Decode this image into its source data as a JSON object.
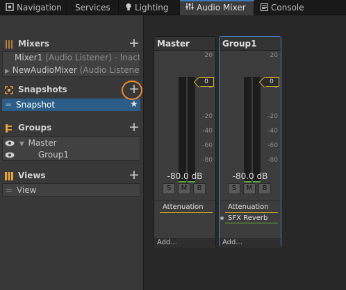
{
  "tabs": {
    "navigation": "Navigation",
    "services": "Services",
    "lighting": "Lighting",
    "audio_mixer": "Audio Mixer",
    "console": "Console"
  },
  "mixers": {
    "title": "Mixers",
    "items": [
      {
        "name": "Mixer1",
        "detail": "(Audio Listener) - Inactive"
      },
      {
        "name": "NewAudioMixer",
        "detail": "(Audio Listener)"
      }
    ]
  },
  "snapshots": {
    "title": "Snapshots",
    "items": [
      {
        "name": "Snapshot"
      }
    ]
  },
  "groups": {
    "title": "Groups",
    "items": [
      {
        "name": "Master"
      },
      {
        "name": "Group1"
      }
    ]
  },
  "views": {
    "title": "Views",
    "items": [
      {
        "name": "View"
      }
    ]
  },
  "strips": [
    {
      "title": "Master",
      "level_db": "-80.0 dB",
      "volume": "0",
      "ticks": [
        "20",
        "0",
        "-20",
        "-40",
        "-60",
        "-80"
      ],
      "solo": "S",
      "mute": "M",
      "bypass": "B",
      "effects": [
        "Attenuation"
      ],
      "add": "Add..."
    },
    {
      "title": "Group1",
      "level_db": "-80.0 dB",
      "volume": "0",
      "ticks": [
        "20",
        "0",
        "-20",
        "-40",
        "-60",
        "-80"
      ],
      "solo": "S",
      "mute": "M",
      "bypass": "B",
      "effects": [
        "Attenuation",
        "SFX Reverb"
      ],
      "add": "Add..."
    }
  ],
  "colors": {
    "accent": "#3a79bb",
    "selection": "#2c5d87",
    "attenuation": "#d4b225",
    "effect": "#6fb33a",
    "highlight_circle": "#f28a2e"
  }
}
